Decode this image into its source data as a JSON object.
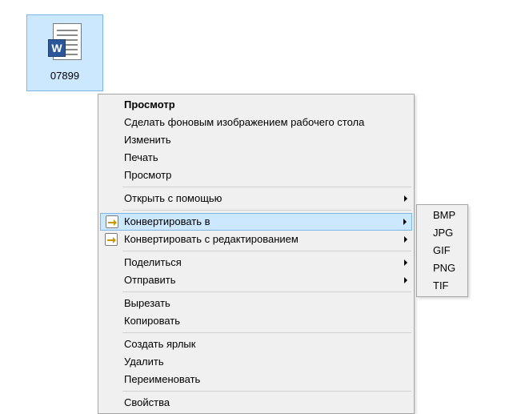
{
  "file": {
    "name": "07899"
  },
  "menu": {
    "items": [
      {
        "label": "Просмотр",
        "bold": true
      },
      {
        "label": "Сделать фоновым изображением рабочего стола"
      },
      {
        "label": "Изменить"
      },
      {
        "label": "Печать"
      },
      {
        "label": "Просмотр"
      },
      {
        "sep": true
      },
      {
        "label": "Открыть с помощью",
        "submenu": true
      },
      {
        "sep": true
      },
      {
        "label": "Конвертировать в",
        "submenu": true,
        "icon": "convert",
        "highlight": true
      },
      {
        "label": "Конвертировать с редактированием",
        "submenu": true,
        "icon": "convert"
      },
      {
        "sep": true
      },
      {
        "label": "Поделиться",
        "submenu": true
      },
      {
        "label": "Отправить",
        "submenu": true
      },
      {
        "sep": true
      },
      {
        "label": "Вырезать"
      },
      {
        "label": "Копировать"
      },
      {
        "sep": true
      },
      {
        "label": "Создать ярлык"
      },
      {
        "label": "Удалить"
      },
      {
        "label": "Переименовать"
      },
      {
        "sep": true
      },
      {
        "label": "Свойства"
      }
    ]
  },
  "submenu": {
    "items": [
      "BMP",
      "JPG",
      "GIF",
      "PNG",
      "TIF"
    ]
  }
}
